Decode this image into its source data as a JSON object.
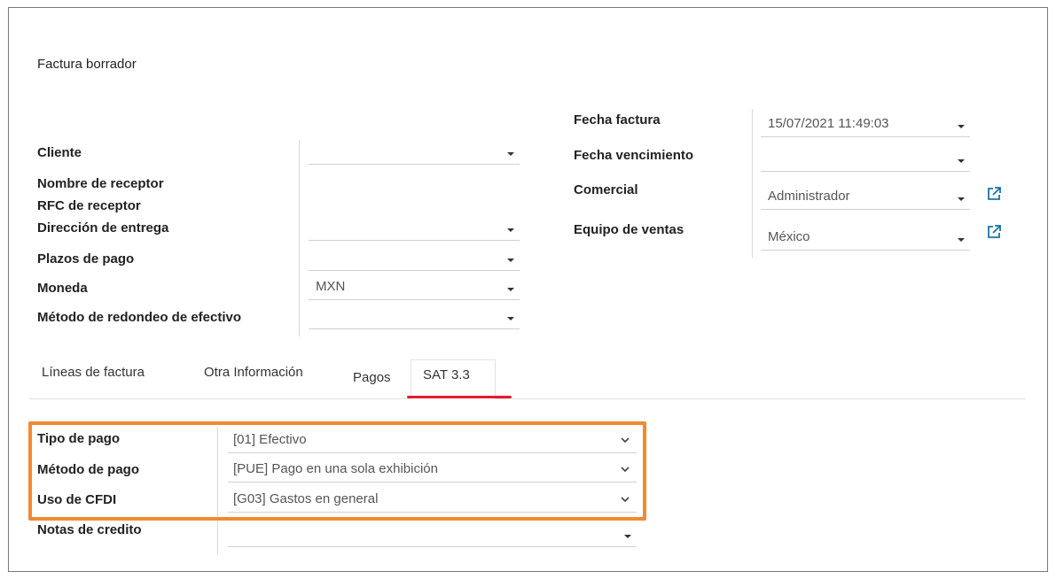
{
  "form": {
    "title": "Factura borrador",
    "left_fields": [
      {
        "label": "Cliente",
        "value": ""
      },
      {
        "label": "Nombre de receptor"
      },
      {
        "label": "RFC de receptor"
      },
      {
        "label": "Dirección de entrega",
        "value": ""
      },
      {
        "label": "Plazos de pago",
        "value": ""
      },
      {
        "label": "Moneda",
        "value": "MXN"
      },
      {
        "label": "Método de redondeo de efectivo",
        "value": ""
      }
    ],
    "right_fields": [
      {
        "label": "Fecha factura",
        "value": "15/07/2021 11:49:03"
      },
      {
        "label": "Fecha vencimiento",
        "value": ""
      },
      {
        "label": "Comercial",
        "value": "Administrador"
      },
      {
        "label": "Equipo de ventas",
        "value": "México"
      }
    ]
  },
  "tabs": [
    {
      "label": "Líneas de factura"
    },
    {
      "label": "Otra Información"
    },
    {
      "label": "Pagos"
    },
    {
      "label": "SAT 3.3",
      "active": true
    }
  ],
  "sat": {
    "fields": [
      {
        "label": "Tipo de pago",
        "value": "[01] Efectivo"
      },
      {
        "label": "Método de pago",
        "value": "[PUE] Pago en una sola exhibición"
      },
      {
        "label": "Uso de CFDI",
        "value": "[G03] Gastos en general"
      },
      {
        "label": "Notas de credito",
        "value": ""
      }
    ]
  },
  "colors": {
    "highlight": "#f28a30",
    "active_tab_underline": "#e11d2f",
    "external_link_icon": "#1a73a8"
  },
  "icons": {
    "dropdown": "caret-down-icon",
    "select": "chevron-down-icon",
    "external_link": "external-link-icon"
  }
}
